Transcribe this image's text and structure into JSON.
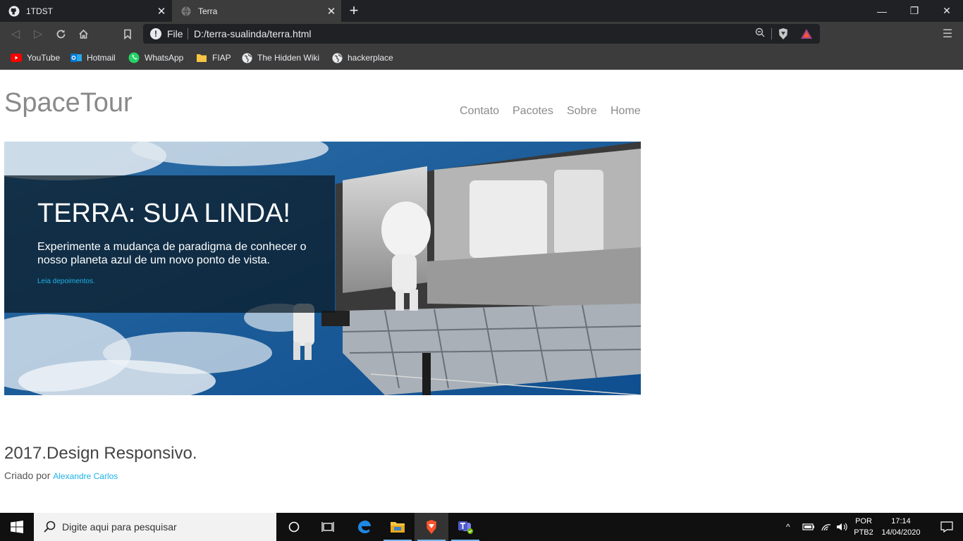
{
  "browser": {
    "tabs": [
      {
        "title": "1TDST",
        "icon": "github-icon",
        "active": false
      },
      {
        "title": "Terra",
        "icon": "globe-icon",
        "active": true
      }
    ],
    "address": {
      "scheme": "File",
      "url": "D:/terra-sualinda/terra.html"
    },
    "bookmarks": [
      {
        "label": "YouTube",
        "icon": "youtube-icon"
      },
      {
        "label": "Hotmail",
        "icon": "outlook-icon"
      },
      {
        "label": "WhatsApp",
        "icon": "whatsapp-icon"
      },
      {
        "label": "FIAP",
        "icon": "folder-icon"
      },
      {
        "label": "The Hidden Wiki",
        "icon": "globe-icon"
      },
      {
        "label": "hackerplace",
        "icon": "globe-icon"
      }
    ]
  },
  "page": {
    "logo": "SpaceTour",
    "nav": [
      "Contato",
      "Pacotes",
      "Sobre",
      "Home"
    ],
    "hero": {
      "title": "TERRA: SUA LINDA!",
      "subtitle": "Experimente a mudança de paradigma de conhecer o nosso planeta azul de um novo ponto de vista.",
      "link": "Leia depoimentos."
    },
    "footer": {
      "title": "2017.Design Responsivo.",
      "credit_prefix": "Criado por",
      "credit_name": "Alexandre Carlos"
    }
  },
  "taskbar": {
    "search_placeholder": "Digite aqui para pesquisar",
    "lang": [
      "POR",
      "PTB2"
    ],
    "time": "17:14",
    "date": "14/04/2020"
  },
  "colors": {
    "accent_link": "#1eb3e8",
    "chrome_dark": "#202124",
    "chrome_mid": "#3c3c3c"
  }
}
